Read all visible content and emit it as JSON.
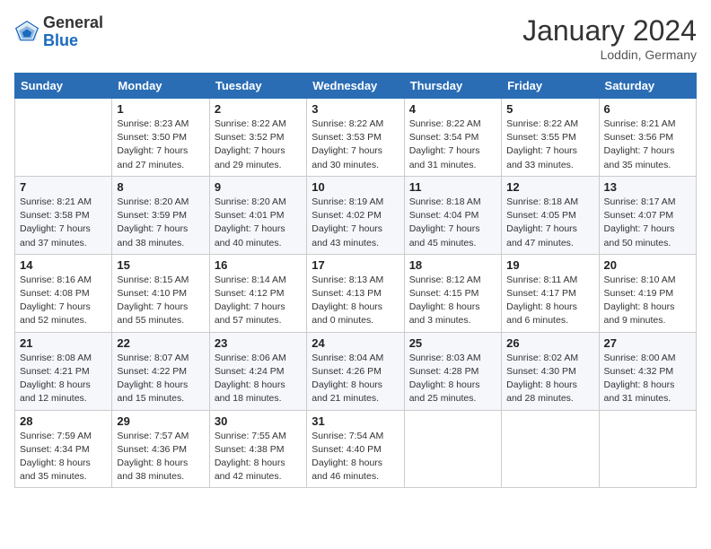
{
  "header": {
    "logo_general": "General",
    "logo_blue": "Blue",
    "month": "January 2024",
    "location": "Loddin, Germany"
  },
  "columns": [
    "Sunday",
    "Monday",
    "Tuesday",
    "Wednesday",
    "Thursday",
    "Friday",
    "Saturday"
  ],
  "weeks": [
    [
      {
        "day": null
      },
      {
        "day": "1",
        "sunrise": "Sunrise: 8:23 AM",
        "sunset": "Sunset: 3:50 PM",
        "daylight": "Daylight: 7 hours and 27 minutes."
      },
      {
        "day": "2",
        "sunrise": "Sunrise: 8:22 AM",
        "sunset": "Sunset: 3:52 PM",
        "daylight": "Daylight: 7 hours and 29 minutes."
      },
      {
        "day": "3",
        "sunrise": "Sunrise: 8:22 AM",
        "sunset": "Sunset: 3:53 PM",
        "daylight": "Daylight: 7 hours and 30 minutes."
      },
      {
        "day": "4",
        "sunrise": "Sunrise: 8:22 AM",
        "sunset": "Sunset: 3:54 PM",
        "daylight": "Daylight: 7 hours and 31 minutes."
      },
      {
        "day": "5",
        "sunrise": "Sunrise: 8:22 AM",
        "sunset": "Sunset: 3:55 PM",
        "daylight": "Daylight: 7 hours and 33 minutes."
      },
      {
        "day": "6",
        "sunrise": "Sunrise: 8:21 AM",
        "sunset": "Sunset: 3:56 PM",
        "daylight": "Daylight: 7 hours and 35 minutes."
      }
    ],
    [
      {
        "day": "7",
        "sunrise": "Sunrise: 8:21 AM",
        "sunset": "Sunset: 3:58 PM",
        "daylight": "Daylight: 7 hours and 37 minutes."
      },
      {
        "day": "8",
        "sunrise": "Sunrise: 8:20 AM",
        "sunset": "Sunset: 3:59 PM",
        "daylight": "Daylight: 7 hours and 38 minutes."
      },
      {
        "day": "9",
        "sunrise": "Sunrise: 8:20 AM",
        "sunset": "Sunset: 4:01 PM",
        "daylight": "Daylight: 7 hours and 40 minutes."
      },
      {
        "day": "10",
        "sunrise": "Sunrise: 8:19 AM",
        "sunset": "Sunset: 4:02 PM",
        "daylight": "Daylight: 7 hours and 43 minutes."
      },
      {
        "day": "11",
        "sunrise": "Sunrise: 8:18 AM",
        "sunset": "Sunset: 4:04 PM",
        "daylight": "Daylight: 7 hours and 45 minutes."
      },
      {
        "day": "12",
        "sunrise": "Sunrise: 8:18 AM",
        "sunset": "Sunset: 4:05 PM",
        "daylight": "Daylight: 7 hours and 47 minutes."
      },
      {
        "day": "13",
        "sunrise": "Sunrise: 8:17 AM",
        "sunset": "Sunset: 4:07 PM",
        "daylight": "Daylight: 7 hours and 50 minutes."
      }
    ],
    [
      {
        "day": "14",
        "sunrise": "Sunrise: 8:16 AM",
        "sunset": "Sunset: 4:08 PM",
        "daylight": "Daylight: 7 hours and 52 minutes."
      },
      {
        "day": "15",
        "sunrise": "Sunrise: 8:15 AM",
        "sunset": "Sunset: 4:10 PM",
        "daylight": "Daylight: 7 hours and 55 minutes."
      },
      {
        "day": "16",
        "sunrise": "Sunrise: 8:14 AM",
        "sunset": "Sunset: 4:12 PM",
        "daylight": "Daylight: 7 hours and 57 minutes."
      },
      {
        "day": "17",
        "sunrise": "Sunrise: 8:13 AM",
        "sunset": "Sunset: 4:13 PM",
        "daylight": "Daylight: 8 hours and 0 minutes."
      },
      {
        "day": "18",
        "sunrise": "Sunrise: 8:12 AM",
        "sunset": "Sunset: 4:15 PM",
        "daylight": "Daylight: 8 hours and 3 minutes."
      },
      {
        "day": "19",
        "sunrise": "Sunrise: 8:11 AM",
        "sunset": "Sunset: 4:17 PM",
        "daylight": "Daylight: 8 hours and 6 minutes."
      },
      {
        "day": "20",
        "sunrise": "Sunrise: 8:10 AM",
        "sunset": "Sunset: 4:19 PM",
        "daylight": "Daylight: 8 hours and 9 minutes."
      }
    ],
    [
      {
        "day": "21",
        "sunrise": "Sunrise: 8:08 AM",
        "sunset": "Sunset: 4:21 PM",
        "daylight": "Daylight: 8 hours and 12 minutes."
      },
      {
        "day": "22",
        "sunrise": "Sunrise: 8:07 AM",
        "sunset": "Sunset: 4:22 PM",
        "daylight": "Daylight: 8 hours and 15 minutes."
      },
      {
        "day": "23",
        "sunrise": "Sunrise: 8:06 AM",
        "sunset": "Sunset: 4:24 PM",
        "daylight": "Daylight: 8 hours and 18 minutes."
      },
      {
        "day": "24",
        "sunrise": "Sunrise: 8:04 AM",
        "sunset": "Sunset: 4:26 PM",
        "daylight": "Daylight: 8 hours and 21 minutes."
      },
      {
        "day": "25",
        "sunrise": "Sunrise: 8:03 AM",
        "sunset": "Sunset: 4:28 PM",
        "daylight": "Daylight: 8 hours and 25 minutes."
      },
      {
        "day": "26",
        "sunrise": "Sunrise: 8:02 AM",
        "sunset": "Sunset: 4:30 PM",
        "daylight": "Daylight: 8 hours and 28 minutes."
      },
      {
        "day": "27",
        "sunrise": "Sunrise: 8:00 AM",
        "sunset": "Sunset: 4:32 PM",
        "daylight": "Daylight: 8 hours and 31 minutes."
      }
    ],
    [
      {
        "day": "28",
        "sunrise": "Sunrise: 7:59 AM",
        "sunset": "Sunset: 4:34 PM",
        "daylight": "Daylight: 8 hours and 35 minutes."
      },
      {
        "day": "29",
        "sunrise": "Sunrise: 7:57 AM",
        "sunset": "Sunset: 4:36 PM",
        "daylight": "Daylight: 8 hours and 38 minutes."
      },
      {
        "day": "30",
        "sunrise": "Sunrise: 7:55 AM",
        "sunset": "Sunset: 4:38 PM",
        "daylight": "Daylight: 8 hours and 42 minutes."
      },
      {
        "day": "31",
        "sunrise": "Sunrise: 7:54 AM",
        "sunset": "Sunset: 4:40 PM",
        "daylight": "Daylight: 8 hours and 46 minutes."
      },
      {
        "day": null
      },
      {
        "day": null
      },
      {
        "day": null
      }
    ]
  ]
}
